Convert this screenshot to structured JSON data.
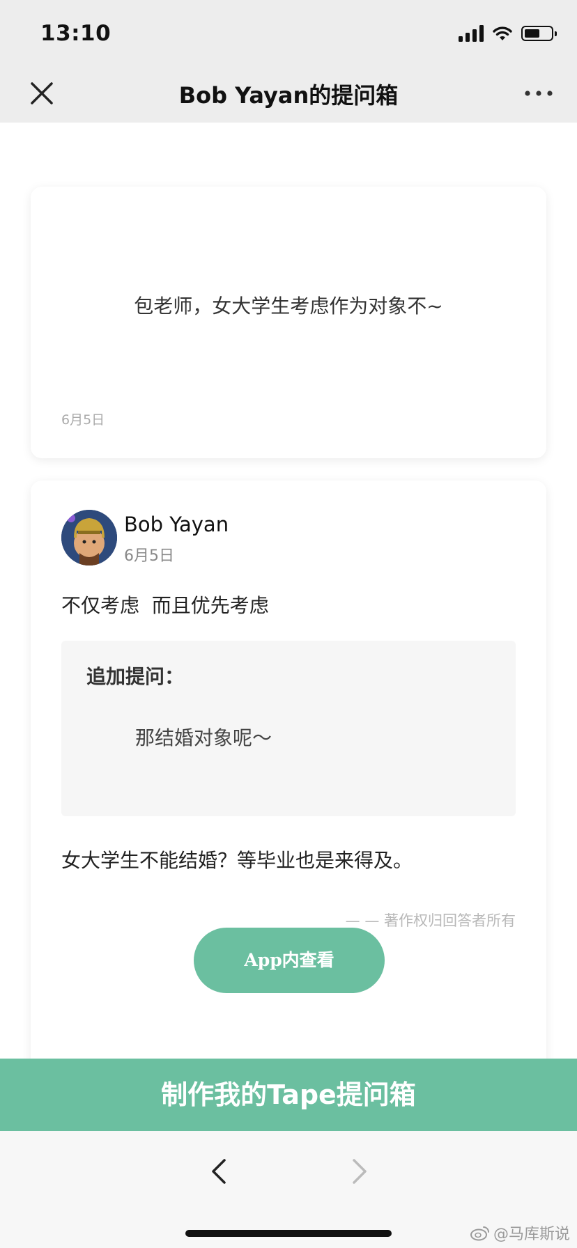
{
  "status_bar": {
    "time": "13:10",
    "icons": [
      "cellular-signal-icon",
      "wifi-icon",
      "battery-icon"
    ],
    "battery_level": 0.6
  },
  "nav": {
    "title": "Bob Yayan的提问箱",
    "close_icon": "close-icon",
    "more_icon": "more-horizontal-icon"
  },
  "question": {
    "text": "包老师，女大学生考虑作为对象不~",
    "date": "6月5日"
  },
  "answer": {
    "author": "Bob Yayan",
    "date": "6月5日",
    "text": "不仅考虑  而且优先考虑",
    "followup_label": "追加提问：",
    "followup_question": "那结婚对象呢～",
    "followup_answer": "女大学生不能结婚？等毕业也是来得及。",
    "copyright": "— — 著作权归回答者所有",
    "app_button_label": "App内查看"
  },
  "cta": {
    "label": "制作我的Tape提问箱"
  },
  "toolbar": {
    "back_icon": "chevron-left-icon",
    "forward_icon": "chevron-right-icon"
  },
  "watermark": {
    "text": "@马库斯说",
    "icon": "weibo-icon"
  },
  "colors": {
    "accent": "#6bbfa0",
    "bar_bg": "#ededed"
  }
}
